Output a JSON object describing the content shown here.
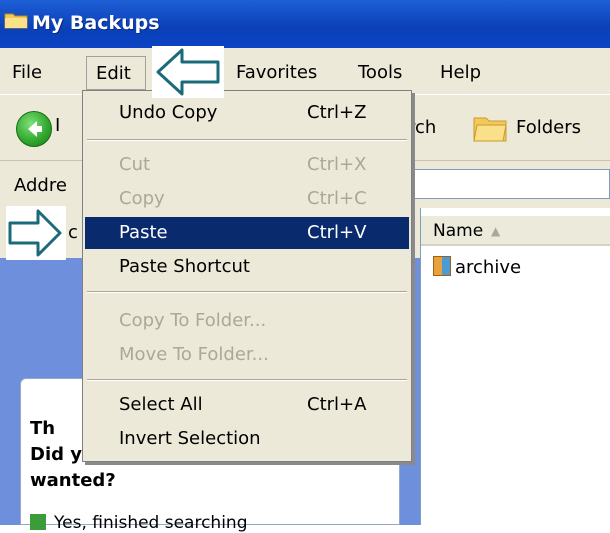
{
  "window": {
    "title": "My Backups"
  },
  "menubar": {
    "items": [
      "File",
      "Edit",
      "Favorites",
      "Tools",
      "Help"
    ]
  },
  "toolbar": {
    "search_partial": "rch",
    "folders_label": "Folders",
    "back_partial": "I"
  },
  "address": {
    "label": "Addre"
  },
  "left_pane": {
    "partial_letter": "c",
    "panel_line1": "Th",
    "panel_line2": "Did you find what you",
    "panel_line3": "wanted?",
    "yes_option": "Yes, finished searching"
  },
  "file_list": {
    "column_name": "Name",
    "items": [
      {
        "name": "archive",
        "icon": "compressed-folder-icon"
      }
    ]
  },
  "edit_menu": {
    "items": [
      {
        "label": "Undo Copy",
        "shortcut": "Ctrl+Z",
        "enabled": true
      },
      {
        "label": "Cut",
        "shortcut": "Ctrl+X",
        "enabled": false
      },
      {
        "label": "Copy",
        "shortcut": "Ctrl+C",
        "enabled": false
      },
      {
        "label": "Paste",
        "shortcut": "Ctrl+V",
        "enabled": true,
        "highlighted": true
      },
      {
        "label": "Paste Shortcut",
        "shortcut": "",
        "enabled": true
      },
      {
        "label": "Copy To Folder...",
        "shortcut": "",
        "enabled": false
      },
      {
        "label": "Move To Folder...",
        "shortcut": "",
        "enabled": false
      },
      {
        "label": "Select All",
        "shortcut": "Ctrl+A",
        "enabled": true
      },
      {
        "label": "Invert Selection",
        "shortcut": "",
        "enabled": true
      }
    ]
  },
  "colors": {
    "highlight": "#0a2a6e",
    "titlebar": "#0a3fb8",
    "menu_bg": "#ece9d8",
    "arrow_stroke": "#1a6a7a"
  }
}
